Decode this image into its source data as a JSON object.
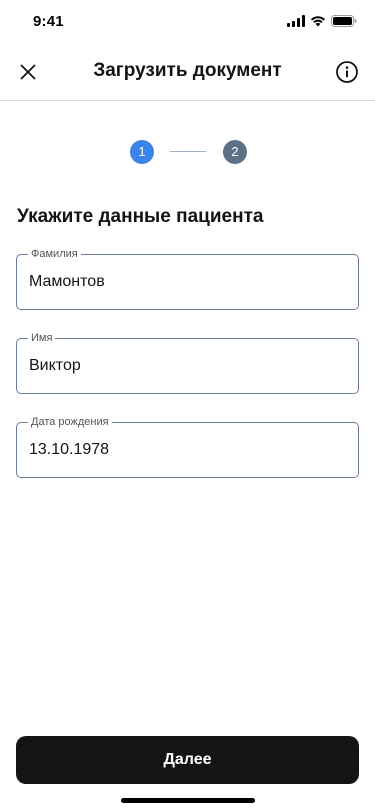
{
  "status_bar": {
    "time": "9:41",
    "icons": [
      "cellular-signal-icon",
      "wifi-icon",
      "battery-icon"
    ]
  },
  "header": {
    "title": "Загрузить документ",
    "close_icon": "close-icon",
    "info_icon": "info-icon"
  },
  "stepper": {
    "steps": [
      "1",
      "2"
    ],
    "current_step": 1,
    "colors": {
      "active": "#3d84e8",
      "inactive": "#5b7185"
    }
  },
  "form": {
    "title": "Укажите данные пациента",
    "fields": [
      {
        "label": "Фамилия",
        "value": "Мамонтов"
      },
      {
        "label": "Имя",
        "value": "Виктор"
      },
      {
        "label": "Дата рождения",
        "value": "13.10.1978"
      }
    ]
  },
  "actions": {
    "next_label": "Далее"
  },
  "colors": {
    "primary_button": "#141414",
    "field_border": "#6a7d94"
  }
}
